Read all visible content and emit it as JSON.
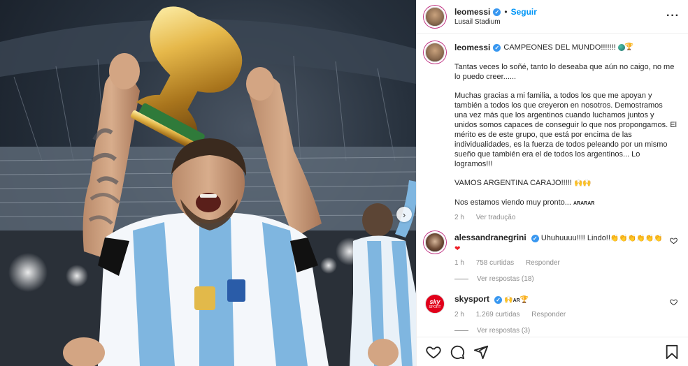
{
  "post": {
    "author": "leomessi",
    "follow_label": "Seguir",
    "separator": "•",
    "location": "Lusail Stadium",
    "more_label": "···",
    "next_label": "›"
  },
  "caption": {
    "author": "leomessi",
    "headline": "CAMPEONES DEL MUNDO!!!!!!!",
    "headline_emoji": "🏆",
    "paragraphs": [
      "Tantas veces lo soñé, tanto lo deseaba que aún no caigo, no me lo puedo creer......",
      "Muchas gracias a mi familia, a todos los que me apoyan y también a todos los que creyeron en nosotros. Demostramos una vez más que los argentinos cuando luchamos juntos y unidos somos capaces de conseguir lo que nos propongamos. El mérito es de este grupo, que está por encima de las individualidades, es la fuerza de todos peleando por un mismo sueño que también era el de todos los argentinos... Lo logramos!!!",
      "VAMOS ARGENTINA CARAJO!!!!!"
    ],
    "vamos_emoji": "🙌🙌",
    "last_line": "Nos estamos viendo muy pronto...",
    "last_tag": "ARARAR",
    "time": "2 h",
    "translate": "Ver tradução"
  },
  "comments": [
    {
      "author": "alessandranegrini",
      "text": "Uhuhuuuu!!!! Lindo!!",
      "claps": "👏👏👏👏👏👏",
      "heart": "❤",
      "time": "1 h",
      "likes": "758 curtidas",
      "reply": "Responder",
      "view_replies": "Ver respostas (18)"
    },
    {
      "author": "skysport",
      "text_emoji": "🙌",
      "text_tag": "AR",
      "trophy": "🏆",
      "avatar_line1": "sky",
      "avatar_line2": "SPORT",
      "time": "2 h",
      "likes": "1.269 curtidas",
      "reply": "Responder",
      "view_replies": "Ver respostas (3)"
    }
  ],
  "icons": {
    "like": "heart-outline-icon",
    "comment": "comment-bubble-icon",
    "share": "paper-plane-icon",
    "save": "bookmark-icon",
    "comment_like": "heart-outline-icon"
  },
  "colors": {
    "link_blue": "#0095f6",
    "verified_blue": "#3897f0",
    "muted": "#8e8e8e",
    "text": "#262626"
  }
}
